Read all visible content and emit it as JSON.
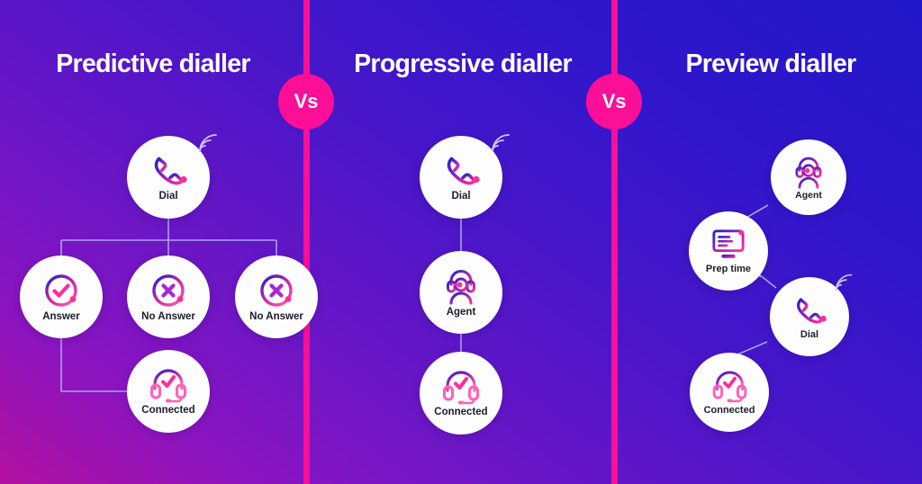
{
  "theme": {
    "bg_gradient_from": "#b2119f",
    "bg_gradient_to": "#2117c8",
    "divider_color": "#fa0f96",
    "node_bg": "#fdfdfd",
    "label_color": "#1d1d2b",
    "connector_color": "#a9a3e8",
    "icon_gradient_from": "#2b21c4",
    "icon_gradient_to": "#ff2d9b"
  },
  "columns": [
    {
      "id": "predictive",
      "title": "Predictive dialler",
      "nodes": [
        {
          "id": "pred-dial",
          "label": "Dial",
          "icon": "phone-handset-icon"
        },
        {
          "id": "pred-answer",
          "label": "Answer",
          "icon": "check-circle-icon"
        },
        {
          "id": "pred-noanswer-1",
          "label": "No Answer",
          "icon": "cross-circle-icon"
        },
        {
          "id": "pred-noanswer-2",
          "label": "No Answer",
          "icon": "cross-circle-icon"
        },
        {
          "id": "pred-connected",
          "label": "Connected",
          "icon": "headset-check-icon"
        }
      ]
    },
    {
      "id": "progressive",
      "title": "Progressive dialler",
      "nodes": [
        {
          "id": "prog-dial",
          "label": "Dial",
          "icon": "phone-handset-icon"
        },
        {
          "id": "prog-agent",
          "label": "Agent",
          "icon": "agent-headset-icon"
        },
        {
          "id": "prog-connected",
          "label": "Connected",
          "icon": "headset-check-icon"
        }
      ]
    },
    {
      "id": "preview",
      "title": "Preview dialler",
      "nodes": [
        {
          "id": "prev-agent",
          "label": "Agent",
          "icon": "agent-headset-icon"
        },
        {
          "id": "prev-prep",
          "label": "Prep time",
          "icon": "monitor-screen-icon"
        },
        {
          "id": "prev-dial",
          "label": "Dial",
          "icon": "phone-handset-icon"
        },
        {
          "id": "prev-connected",
          "label": "Connected",
          "icon": "headset-check-icon"
        }
      ]
    }
  ],
  "separators": [
    {
      "id": "vs-1",
      "label": "Vs"
    },
    {
      "id": "vs-2",
      "label": "Vs"
    }
  ]
}
